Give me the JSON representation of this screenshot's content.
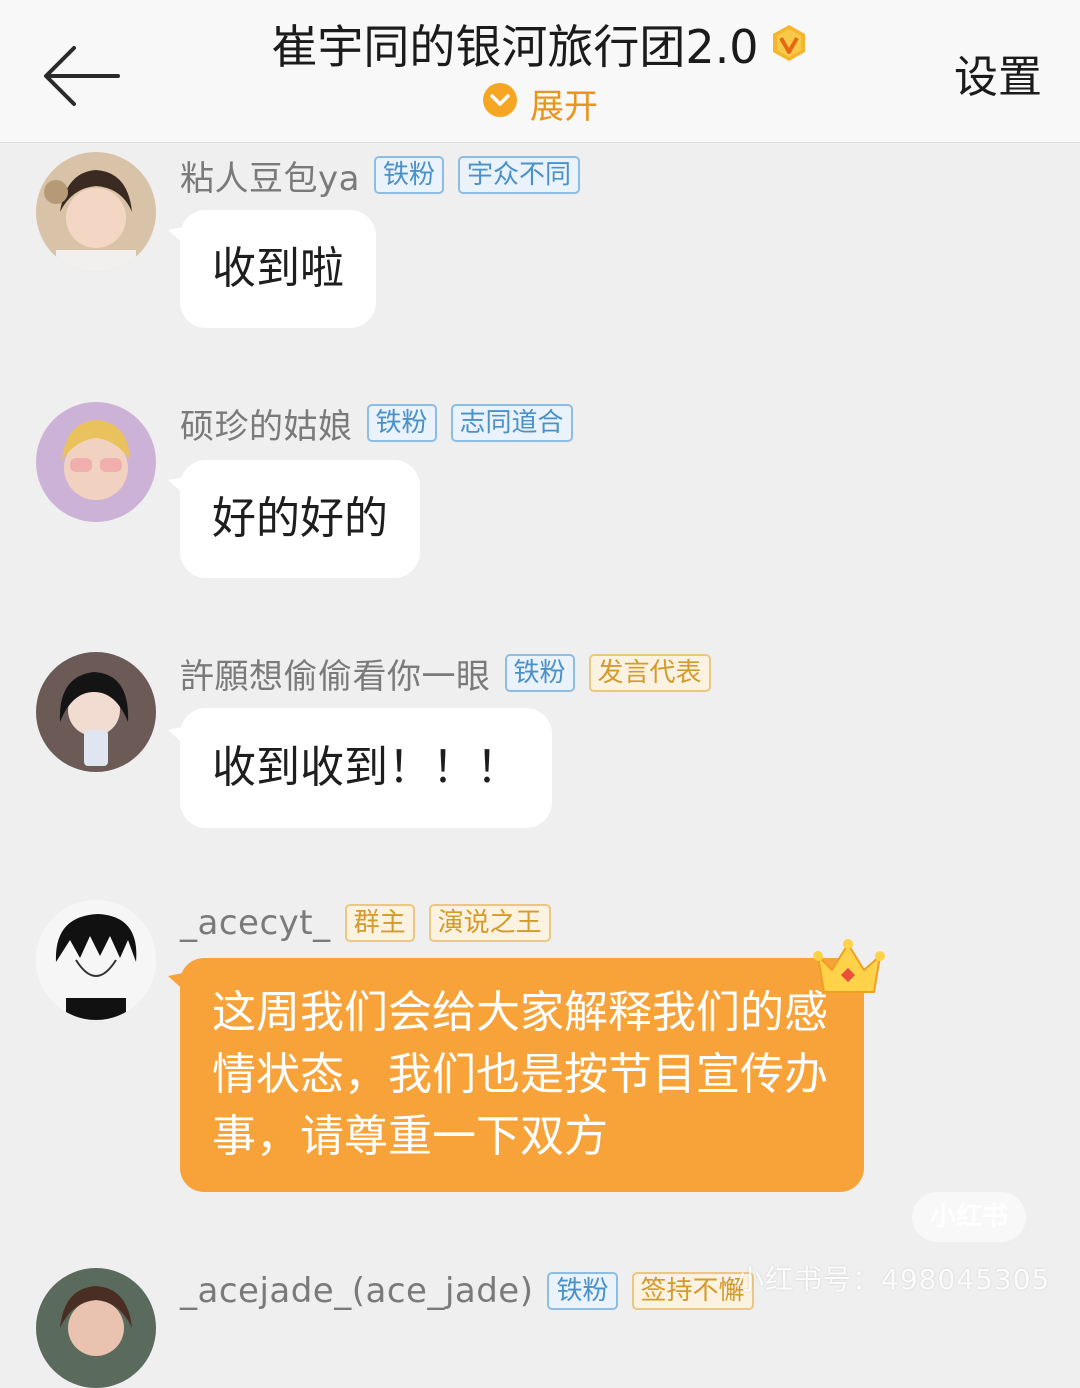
{
  "header": {
    "title": "崔宇同的银河旅行团2.0",
    "expand_label": "展开",
    "settings_label": "设置",
    "accent_color": "#e8951c"
  },
  "messages": [
    {
      "username": "粘人豆包ya",
      "tags": [
        "铁粉",
        "宇众不同"
      ],
      "text": "收到啦"
    },
    {
      "username": "硕珍的姑娘",
      "tags": [
        "铁粉",
        "志同道合"
      ],
      "text": "好的好的"
    },
    {
      "username": "許願想偷偷看你一眼",
      "tags": [
        "铁粉",
        "发言代表"
      ],
      "text": "收到收到！！！"
    },
    {
      "username": "_acecyt_",
      "tags": [
        "群主",
        "演说之王"
      ],
      "text": "这周我们会给大家解释我们的感情状态，我们也是按节目宣传办事，请尊重一下双方"
    },
    {
      "username": "_acejade_(ace_jade)",
      "tags": [
        "铁粉",
        "签持不懈"
      ],
      "text": ""
    }
  ],
  "watermark": {
    "logo_text": "小红书",
    "account_text": "小红书号：498045305"
  }
}
